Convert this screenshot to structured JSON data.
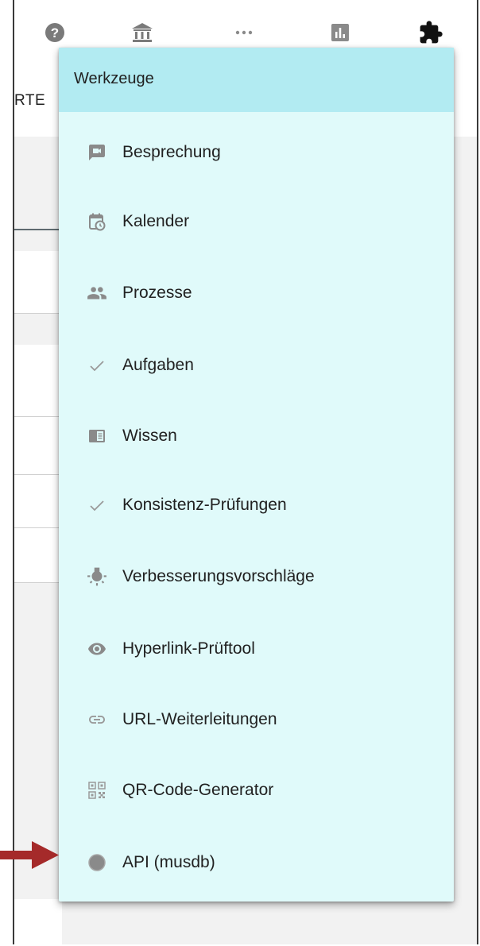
{
  "toolbar": {
    "icons": [
      "help-icon",
      "bank-icon",
      "more-horizontal-icon",
      "bar-chart-icon",
      "puzzle-icon"
    ]
  },
  "background": {
    "subbar_text": "RTE"
  },
  "menu": {
    "title": "Werkzeuge",
    "items": [
      {
        "label": "Besprechung",
        "icon": "video-chat-icon"
      },
      {
        "label": "Kalender",
        "icon": "calendar-clock-icon"
      },
      {
        "label": "Prozesse",
        "icon": "people-icon"
      },
      {
        "label": "Aufgaben",
        "icon": "check-icon"
      },
      {
        "label": "Wissen",
        "icon": "book-icon"
      },
      {
        "label": "Konsistenz-Prüfungen",
        "icon": "check-icon"
      },
      {
        "label": "Verbesserungsvorschläge",
        "icon": "lightbulb-icon"
      },
      {
        "label": "Hyperlink-Prüftool",
        "icon": "eye-icon"
      },
      {
        "label": "URL-Weiterleitungen",
        "icon": "link-icon"
      },
      {
        "label": "QR-Code-Generator",
        "icon": "qr-code-icon"
      },
      {
        "label": "API (musdb)",
        "icon": "circle-icon"
      }
    ]
  },
  "colors": {
    "menu_background": "#e0fafa",
    "menu_header": "#b2ebf2",
    "icon_grey": "#8a8a8a",
    "arrow_red": "#a52a2a"
  }
}
